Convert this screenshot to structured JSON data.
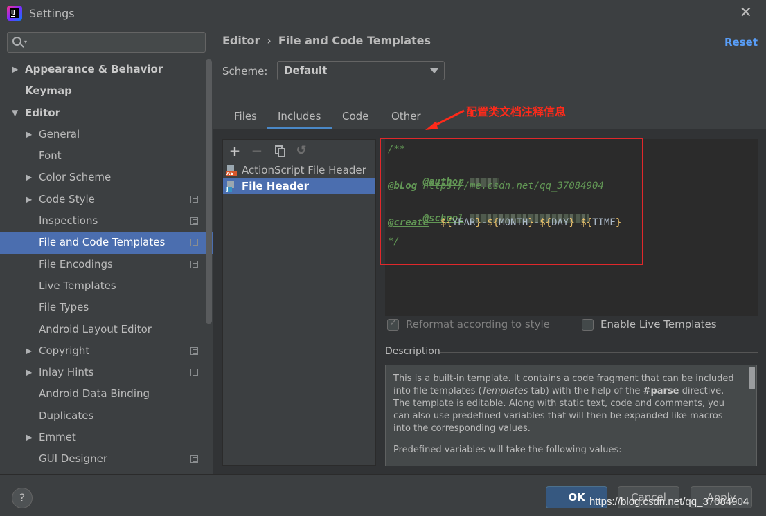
{
  "window": {
    "title": "Settings"
  },
  "search": {
    "placeholder": ""
  },
  "sidebar": {
    "items": [
      {
        "label": "Appearance & Behavior",
        "arrow": "▶"
      },
      {
        "label": "Keymap",
        "arrow": ""
      },
      {
        "label": "Editor",
        "arrow": "▼"
      },
      {
        "label": "General",
        "arrow": "▶"
      },
      {
        "label": "Font",
        "arrow": ""
      },
      {
        "label": "Color Scheme",
        "arrow": "▶"
      },
      {
        "label": "Code Style",
        "arrow": "▶"
      },
      {
        "label": "Inspections",
        "arrow": ""
      },
      {
        "label": "File and Code Templates",
        "arrow": ""
      },
      {
        "label": "File Encodings",
        "arrow": ""
      },
      {
        "label": "Live Templates",
        "arrow": ""
      },
      {
        "label": "File Types",
        "arrow": ""
      },
      {
        "label": "Android Layout Editor",
        "arrow": ""
      },
      {
        "label": "Copyright",
        "arrow": "▶"
      },
      {
        "label": "Inlay Hints",
        "arrow": "▶"
      },
      {
        "label": "Android Data Binding",
        "arrow": ""
      },
      {
        "label": "Duplicates",
        "arrow": ""
      },
      {
        "label": "Emmet",
        "arrow": "▶"
      },
      {
        "label": "GUI Designer",
        "arrow": ""
      }
    ]
  },
  "header": {
    "breadcrumb_parent": "Editor",
    "breadcrumb_sep": "›",
    "breadcrumb_current": "File and Code Templates",
    "reset_label": "Reset"
  },
  "scheme": {
    "label": "Scheme:",
    "value": "Default"
  },
  "tabs": [
    "Files",
    "Includes",
    "Code",
    "Other"
  ],
  "annotation": {
    "text": "配置类文档注释信息"
  },
  "toolbar": {
    "add": "+",
    "remove": "−",
    "revert": "↺"
  },
  "templates": [
    {
      "name": "ActionScript File Header",
      "icon": "AS"
    },
    {
      "name": "File Header",
      "icon": "J"
    }
  ],
  "editor": {
    "line1": "/**",
    "author_tag": "@author",
    "blog_tag": "@bLog",
    "blog_url": " https://me.csdn.net/qq_37084904",
    "school_tag": "@school",
    "create_tag": "@create",
    "create_vars": [
      {
        "open": "${",
        "name": "YEAR",
        "close": "}"
      },
      {
        "sep": "-",
        "open": "${",
        "name": "MONTH",
        "close": "}"
      },
      {
        "sep": "-",
        "open": "${",
        "name": "DAY",
        "close": "}"
      },
      {
        "sep": " ",
        "open": "${",
        "name": "TIME",
        "close": "}"
      }
    ],
    "line_end": "*/"
  },
  "options": {
    "reformat_label": "Reformat according to style",
    "live_templates_label": "Enable Live Templates"
  },
  "description": {
    "title": "Description",
    "p1_a": "This is a built-in template. It contains a code fragment that can be included into file templates (",
    "p1_em": "Templates",
    "p1_b": " tab) with the help of the ",
    "p1_code": "#parse",
    "p1_c": " directive.",
    "p1_d": "The template is editable. Along with static text, code and comments, you can also use predefined variables that will then be expanded like macros into the corresponding values.",
    "p2": "Predefined variables will take the following values:"
  },
  "footer": {
    "help": "?",
    "ok": "OK",
    "cancel": "Cancel",
    "apply": "Apply",
    "watermark": "https://blog.csdn.net/qq_37084904"
  }
}
